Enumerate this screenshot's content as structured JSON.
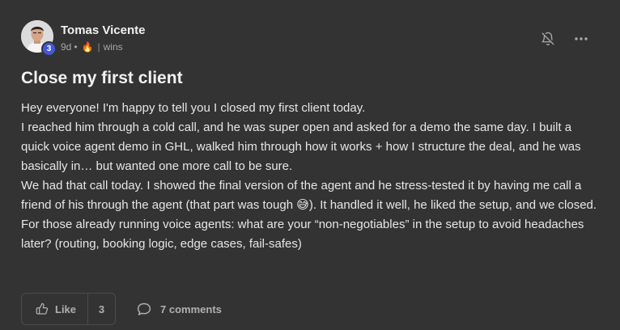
{
  "post": {
    "author": "Tomas Vicente",
    "level": "3",
    "time_ago": "9d",
    "dot": "•",
    "fire_emoji": "🔥",
    "separator": "|",
    "category": "wins",
    "title": "Close my first client",
    "body": {
      "line1": "Hey everyone! I'm happy to tell you I closed my first client today.",
      "line2": "I reached him through a cold call, and he was super open and asked for a demo the same day. I built a quick voice agent demo in GHL, walked him through how it works + how I structure the deal, and he was basically in… but wanted one more call to be sure.",
      "line3_before_emoji": "We had that call today. I showed the final version of the agent and he stress-tested it by having me call a friend of his through the agent (that part was tough ",
      "emoji": "😅",
      "line3_after_emoji": "). It handled it well, he liked the setup, and we closed.",
      "line4": "For those already running voice agents: what are your “non-negotiables” in the setup to avoid headaches later? (routing, booking logic, edge cases, fail-safes)"
    },
    "likes": {
      "label": "Like",
      "count": "3"
    },
    "comments_label": "7 comments"
  },
  "icons": {
    "notification": "bell-off-icon",
    "more": "more-horizontal-icon",
    "like": "thumbs-up-icon",
    "comments": "chat-bubble-icon"
  },
  "colors": {
    "background": "#333333",
    "badge": "#4457d8",
    "text": "#e6e6e6",
    "muted": "#a7a7a7"
  }
}
